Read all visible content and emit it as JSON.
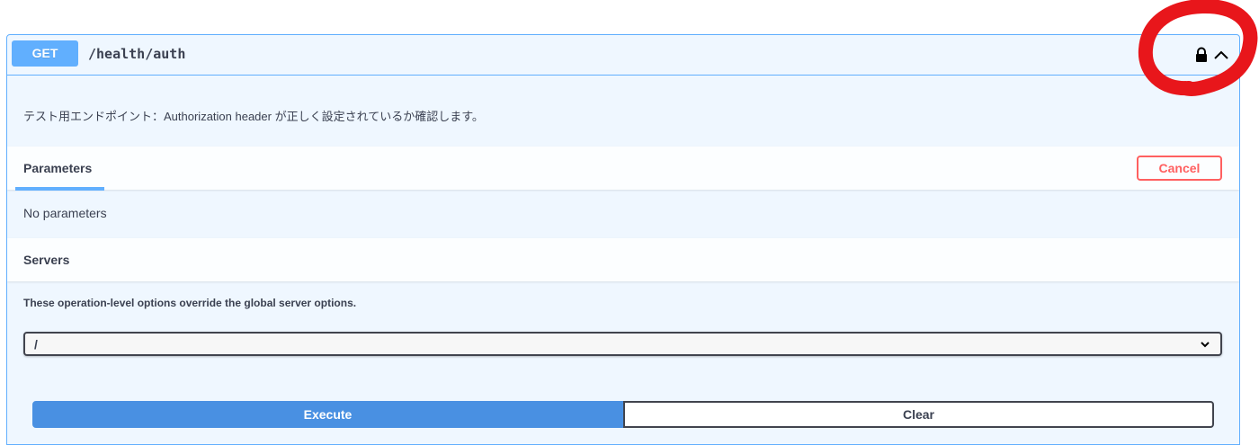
{
  "operation": {
    "method": "GET",
    "path": "/health/auth",
    "description": "テスト用エンドポイント：Authorization header が正しく設定されているか確認します。",
    "lock_icon": "lock-icon",
    "collapse_icon": "chevron-up-icon",
    "method_color": "#61affe"
  },
  "parameters": {
    "title": "Parameters",
    "cancel_label": "Cancel",
    "empty_text": "No parameters"
  },
  "servers": {
    "title": "Servers",
    "note": "These operation-level options override the global server options.",
    "selected": "/"
  },
  "actions": {
    "execute_label": "Execute",
    "clear_label": "Clear",
    "execute_color": "#4990e2"
  },
  "annotation": {
    "color": "#e8161b",
    "shape": "hand-drawn-circle"
  }
}
